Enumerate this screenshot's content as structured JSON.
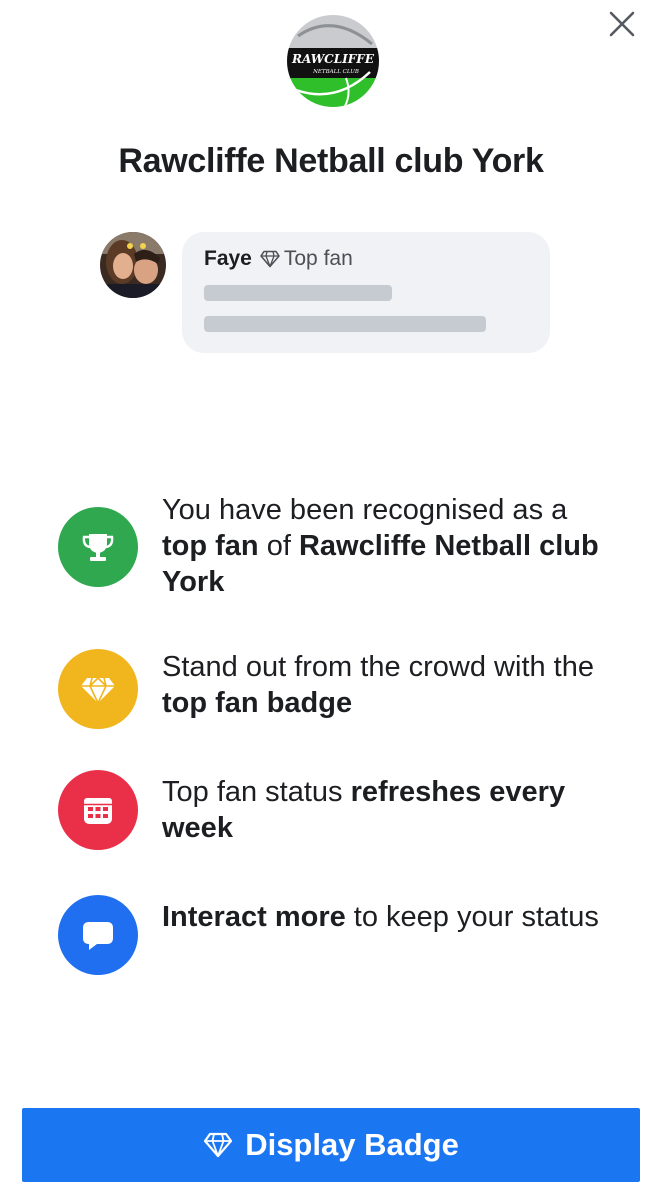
{
  "club": {
    "logo_text_main": "RAWCLIFFE",
    "logo_text_sub": "NETBALL CLUB",
    "title": "Rawcliffe Netball club York"
  },
  "close_icon": "close-icon",
  "preview": {
    "name": "Faye",
    "badge_icon": "diamond-icon",
    "badge_label": "Top fan"
  },
  "features": [
    {
      "icon": "trophy-icon",
      "color": "#2fa84f",
      "parts": [
        "You have been recognised as a ",
        "top fan",
        " of ",
        "Rawcliffe Netball club York"
      ]
    },
    {
      "icon": "diamond-icon",
      "color": "#f1b51d",
      "parts": [
        "Stand out from the crowd with the ",
        "top fan badge"
      ]
    },
    {
      "icon": "calendar-icon",
      "color": "#ea2f49",
      "parts": [
        "Top fan status ",
        "refreshes every week"
      ]
    },
    {
      "icon": "chat-bubble-icon",
      "color": "#1f6ff0",
      "parts": [
        "Interact more",
        " to keep your status"
      ]
    }
  ],
  "button": {
    "icon": "diamond-icon",
    "label": "Display Badge",
    "color": "#1b76f2"
  }
}
